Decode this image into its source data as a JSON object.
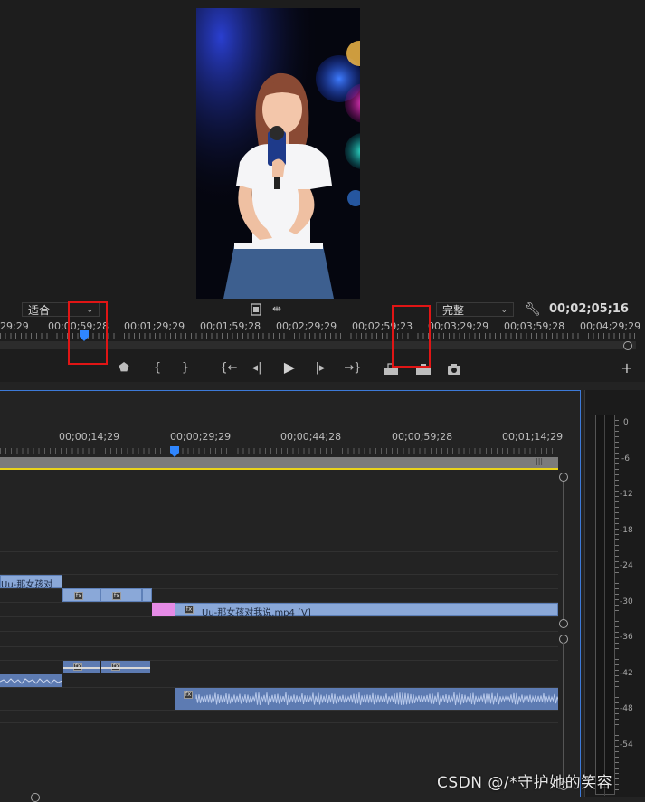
{
  "monitor": {
    "fit_label": "适合",
    "quality_label": "完整",
    "current_timecode": "00;02;05;16",
    "ruler_timecodes": [
      "29;29",
      "00;00;59;28",
      "00;01;29;29",
      "00;01;59;28",
      "00;02;29;29",
      "00;02;59;23",
      "00;03;29;29",
      "00;03;59;28",
      "00;04;29;29"
    ],
    "controls": {
      "marker": "⬟",
      "mark_in": "{",
      "mark_out": "}",
      "go_in": "{←",
      "step_back": "◂|",
      "play": "▶",
      "step_fwd": "|▸",
      "go_out": "→}",
      "lift": "⊓",
      "extract": "⊟",
      "camera": "◙",
      "add": "+"
    }
  },
  "timeline": {
    "timecodes": [
      "00;00;14;29",
      "00;00;29;29",
      "00;00;44;28",
      "00;00;59;28",
      "00;01;14;29"
    ],
    "clip_v2_label": "Uu-那女孩对",
    "clip_v1_label": "Uu-那女孩对我说.mp4 [V]",
    "fx_label": "fx"
  },
  "meter": {
    "db_labels": [
      "0",
      "-6",
      "-12",
      "-18",
      "-24",
      "-30",
      "-36",
      "-42",
      "-48",
      "-54"
    ]
  },
  "watermark": "CSDN @/*守护她的笑容",
  "colors": {
    "accent_blue": "#2f86ff",
    "clip_blue": "#8aa8d8",
    "pink": "#e58be6",
    "red_annotation": "#e01515",
    "yellow_line": "#e8d21a"
  }
}
